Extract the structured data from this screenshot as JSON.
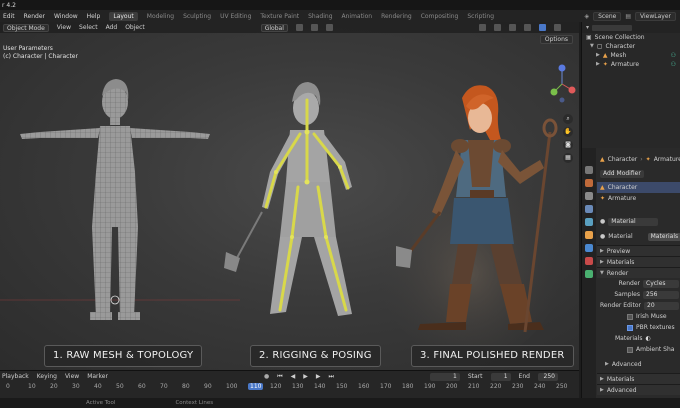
{
  "app": {
    "title": "r 4.2"
  },
  "menu": [
    "Edit",
    "Render",
    "Window",
    "Help"
  ],
  "workspaces": [
    "Layout",
    "Modeling",
    "Sculpting",
    "UV Editing",
    "Texture Paint",
    "Shading",
    "Animation",
    "Rendering",
    "Compositing",
    "Scripting"
  ],
  "top_right": {
    "scene": "Scene",
    "view_layer": "ViewLayer"
  },
  "viewport": {
    "mode": "Object Mode",
    "menus": [
      "View",
      "Select",
      "Add",
      "Object"
    ],
    "orientation": "Global",
    "info_line1": "User Parameters",
    "info_line2": "(c) Character | Character",
    "options": "Options"
  },
  "captions": [
    "1. RAW MESH & TOPOLOGY",
    "2. RIGGING & POSING",
    "3. FINAL POLISHED RENDER"
  ],
  "outliner": {
    "header": "Scene Collection",
    "items": [
      "Character",
      "Mesh",
      "Armature"
    ]
  },
  "properties": {
    "breadcrumb": [
      "Character",
      "Armature"
    ],
    "add_modifier": "Add Modifier",
    "objects": [
      "Character",
      "Armature"
    ],
    "material_slot": "Material",
    "material_tab": "Material",
    "materials_tab": "Materials",
    "panels": [
      "Preview",
      "Materials",
      "Render"
    ],
    "render_engine_label": "Render",
    "render_engine": "Cycles",
    "samples_label": "Samples",
    "samples": "256",
    "render_editor_label": "Render Editor",
    "render_editor": "20",
    "checks": [
      "Irish Muse",
      "PBR textures"
    ],
    "materials_label": "Materials",
    "ambient": "Ambient Sha",
    "advanced": "Advanced",
    "bottom_panels": [
      "Materials",
      "Advanced"
    ]
  },
  "timeline": {
    "menus": [
      "Playback",
      "Keying",
      "View",
      "Marker"
    ],
    "current_frame": "1",
    "start_label": "Start",
    "start": "1",
    "end_label": "End",
    "end": "250",
    "ticks": [
      "0",
      "10",
      "20",
      "30",
      "40",
      "50",
      "60",
      "70",
      "80",
      "90",
      "100",
      "110",
      "120",
      "130",
      "140",
      "150",
      "160",
      "170",
      "180",
      "190",
      "200",
      "210",
      "220",
      "230",
      "240",
      "250"
    ]
  },
  "statusbar": [
    "Active Tool",
    "Context Lines"
  ],
  "colors": {
    "accent_orange": "#e8a14a",
    "rig_yellow": "#d8d84a",
    "select_blue": "#4a78c8"
  }
}
